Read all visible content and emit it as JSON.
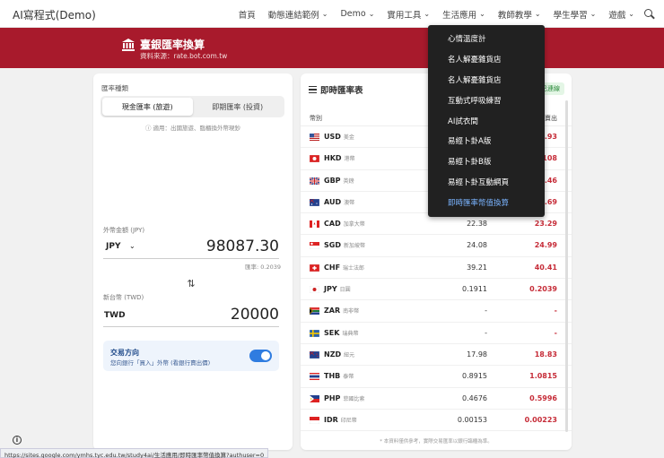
{
  "app": {
    "brand": "AI寫程式(Demo)"
  },
  "nav": {
    "items": [
      {
        "label": "首頁",
        "chevron": false
      },
      {
        "label": "動態連結範例",
        "chevron": true
      },
      {
        "label": "Demo",
        "chevron": true
      },
      {
        "label": "實用工具",
        "chevron": true
      },
      {
        "label": "生活應用",
        "chevron": true
      },
      {
        "label": "教師教學",
        "chevron": true
      },
      {
        "label": "學生學習",
        "chevron": true
      },
      {
        "label": "遊戲",
        "chevron": true
      }
    ],
    "search_icon": "search-icon"
  },
  "banner": {
    "title": "臺銀匯率換算",
    "source": "資料來源：rate.bot.com.tw",
    "icon": "bank-icon",
    "color": "#a81a2c"
  },
  "converter": {
    "rate_type_label": "匯率種類",
    "tabs": [
      "現金匯率 (旅遊)",
      "即期匯率 (投資)"
    ],
    "active_tab": 0,
    "hint": "適用：出國旅遊、臨櫃換外幣現鈔",
    "foreign_label": "外幣金額 (JPY)",
    "foreign_currency": "JPY",
    "foreign_amount": "98087.30",
    "rate_note": "匯率: 0.2039",
    "twd_label": "新台幣 (TWD)",
    "twd_currency": "TWD",
    "twd_amount": "20000",
    "trade_title": "交易方向",
    "trade_desc": "您向銀行「買入」外幣 (看銀行賣出價)",
    "toggle_on": true
  },
  "rates": {
    "title": "即時匯率表",
    "badge": "已連線",
    "col_currency": "幣別",
    "col_sell": "賣出",
    "rows": [
      {
        "code": "USD",
        "name": "美金",
        "buy": "",
        "sell": "31.93",
        "flag": "us"
      },
      {
        "code": "HKD",
        "name": "港幣",
        "buy": "",
        "sell": "4.108",
        "flag": "hk"
      },
      {
        "code": "GBP",
        "name": "英鎊",
        "buy": "",
        "sell": "43.46",
        "flag": "gb"
      },
      {
        "code": "AUD",
        "name": "澳幣",
        "buy": "",
        "sell": "21.69",
        "flag": "au"
      },
      {
        "code": "CAD",
        "name": "加拿大幣",
        "buy": "22.38",
        "sell": "23.29",
        "flag": "ca"
      },
      {
        "code": "SGD",
        "name": "新加坡幣",
        "buy": "24.08",
        "sell": "24.99",
        "flag": "sg"
      },
      {
        "code": "CHF",
        "name": "瑞士法郎",
        "buy": "39.21",
        "sell": "40.41",
        "flag": "ch"
      },
      {
        "code": "JPY",
        "name": "日圓",
        "buy": "0.1911",
        "sell": "0.2039",
        "flag": "jp"
      },
      {
        "code": "ZAR",
        "name": "南非幣",
        "buy": "-",
        "sell": "-",
        "flag": "za"
      },
      {
        "code": "SEK",
        "name": "瑞典幣",
        "buy": "-",
        "sell": "-",
        "flag": "se"
      },
      {
        "code": "NZD",
        "name": "紐元",
        "buy": "17.98",
        "sell": "18.83",
        "flag": "nz"
      },
      {
        "code": "THB",
        "name": "泰幣",
        "buy": "0.8915",
        "sell": "1.0815",
        "flag": "th"
      },
      {
        "code": "PHP",
        "name": "菲國比索",
        "buy": "0.4676",
        "sell": "0.5996",
        "flag": "ph"
      },
      {
        "code": "IDR",
        "name": "印尼幣",
        "buy": "0.00153",
        "sell": "0.00223",
        "flag": "id"
      }
    ],
    "footnote": "* 本資料僅供參考，實際交易匯率以銀行臨櫃為準。"
  },
  "dropdown": {
    "items": [
      {
        "label": "心情溫度計",
        "active": false
      },
      {
        "label": "名人解憂雜貨店",
        "active": false
      },
      {
        "label": "名人解憂雜貨店",
        "active": false
      },
      {
        "label": "互動式呼吸練習",
        "active": false
      },
      {
        "label": "AI試衣間",
        "active": false
      },
      {
        "label": "易經卜卦A版",
        "active": false
      },
      {
        "label": "易經卜卦B版",
        "active": false
      },
      {
        "label": "易經卜卦互動網頁",
        "active": false
      },
      {
        "label": "即時匯率幣值換算",
        "active": true
      }
    ]
  },
  "status": {
    "url": "https://sites.google.com/ymhs.tyc.edu.tw/study4ai/生活應用/即時匯率幣值換算?authuser=0"
  }
}
